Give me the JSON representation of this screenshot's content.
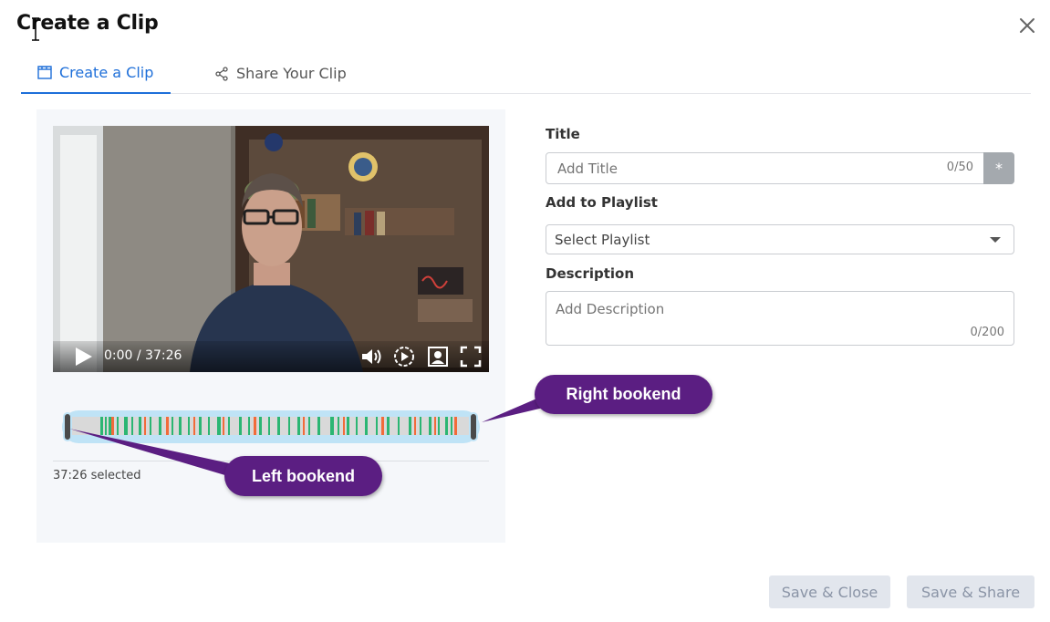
{
  "dialog": {
    "title": "Create a Clip"
  },
  "tabs": [
    {
      "label": "Create a Clip",
      "icon": "clapperboard-icon",
      "active": true
    },
    {
      "label": "Share Your Clip",
      "icon": "share-icon",
      "active": false
    }
  ],
  "player": {
    "time": "0:00 / 37:26"
  },
  "timeline": {
    "selected_text": "37:26 selected"
  },
  "form": {
    "title_label": "Title",
    "title_placeholder": "Add Title",
    "title_counter": "0/50",
    "required_mark": "*",
    "playlist_label": "Add to Playlist",
    "playlist_placeholder": "Select Playlist",
    "description_label": "Description",
    "description_placeholder": "Add Description",
    "description_counter": "0/200"
  },
  "callouts": {
    "right": "Right bookend",
    "left": "Left bookend"
  },
  "buttons": {
    "save_close": "Save & Close",
    "save_share": "Save & Share"
  },
  "colors": {
    "accent": "#1e6fd9",
    "callout": "#5b1e82",
    "timeline_highlight": "#bfe3f6"
  }
}
